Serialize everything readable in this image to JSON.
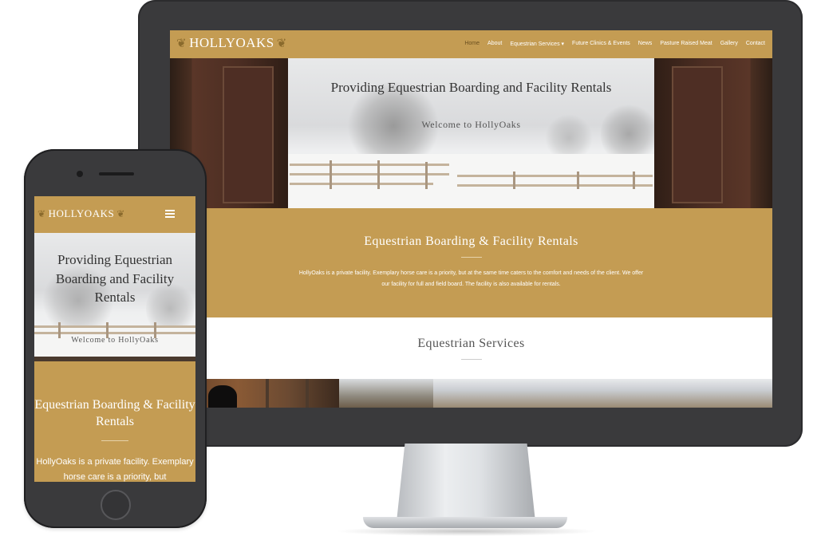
{
  "site": {
    "logo": "HOLLYOAKS"
  },
  "nav": {
    "items": [
      "Home",
      "About",
      "Equestrian Services ▾",
      "Future Clinics & Events",
      "News",
      "Pasture Raised Meat",
      "Gallery",
      "Contact"
    ],
    "active_index": 0
  },
  "hero": {
    "title": "Providing Equestrian Boarding and Facility Rentals",
    "subtitle": "Welcome to HollyOaks"
  },
  "boarding": {
    "title": "Equestrian Boarding & Facility Rentals",
    "body": "HollyOaks is a private facility. Exemplary horse care is a priority, but at the same time caters to the comfort and needs of the client. We offer our facility for full and field board. The facility is also available for rentals."
  },
  "services": {
    "title": "Equestrian Services"
  },
  "mobile": {
    "hero_title": "Providing Equestrian Boarding and Facility Rentals",
    "boarding_title": "Equestrian Boarding & Facility Rentals",
    "body_visible": "HollyOaks is a private facility. Exemplary horse care is a priority, but"
  },
  "colors": {
    "gold": "#c49c53",
    "device": "#3a3a3c"
  }
}
